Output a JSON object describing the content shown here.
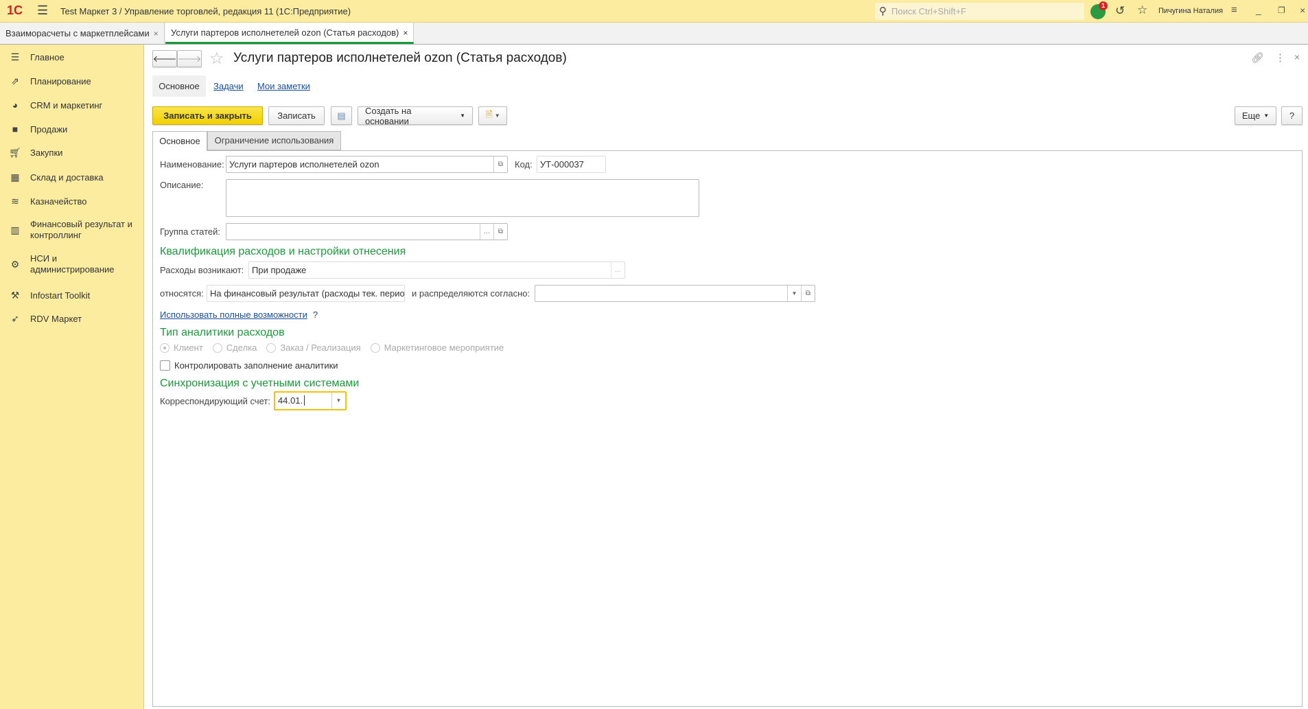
{
  "titlebar": {
    "logo": "1С",
    "title": "Test Маркет 3 / Управление торговлей, редакция 11  (1С:Предприятие)",
    "search_placeholder": "Поиск Ctrl+Shift+F",
    "notification_count": "1",
    "user": "Пичугина Наталия"
  },
  "window_tabs": [
    {
      "label": "Взаиморасчеты с маркетплейсами",
      "close": "×"
    },
    {
      "label": "Услуги партеров исполнетелей ozon (Статья расходов)",
      "close": "×"
    }
  ],
  "sidebar": {
    "items": [
      {
        "label": "Главное",
        "icon": "menu-icon"
      },
      {
        "label": "Планирование",
        "icon": "planning-icon"
      },
      {
        "label": "CRM и маркетинг",
        "icon": "pie-icon"
      },
      {
        "label": "Продажи",
        "icon": "bag-icon"
      },
      {
        "label": "Закупки",
        "icon": "cart-icon"
      },
      {
        "label": "Склад и доставка",
        "icon": "grid-icon"
      },
      {
        "label": "Казначейство",
        "icon": "coins-icon"
      },
      {
        "label": "Финансовый результат и контроллинг",
        "icon": "bar-chart-icon"
      },
      {
        "label": "НСИ и администрирование",
        "icon": "gear-icon"
      },
      {
        "label": "Infostart Toolkit",
        "icon": "tools-icon"
      },
      {
        "label": "RDV Маркет",
        "icon": "rocket-icon"
      }
    ]
  },
  "form": {
    "title": "Услуги партеров исполнетелей ozon (Статья расходов)",
    "subtabs": [
      "Основное",
      "Задачи",
      "Мои заметки"
    ],
    "toolbar": {
      "save_close": "Записать и закрыть",
      "save": "Записать",
      "create_based": "Создать на основании",
      "more": "Еще",
      "help": "?"
    },
    "tabs": [
      "Основное",
      "Ограничение использования"
    ],
    "name_label": "Наименование:",
    "name_value": "Услуги партеров исполнетелей ozon",
    "code_label": "Код:",
    "code_value": "УТ-000037",
    "desc_label": "Описание:",
    "desc_value": "",
    "group_label": "Группа статей:",
    "group_value": "",
    "section1": "Квалификация расходов и настройки отнесения",
    "arise_label": "Расходы возникают:",
    "arise_value": "При продаже",
    "relate_label": "относятся:",
    "relate_value": "На финансовый результат (расходы тек. перио,",
    "distribute_label": "и распределяются согласно:",
    "distribute_value": "",
    "full_link": "Использовать полные возможности",
    "full_help": "?",
    "section2": "Тип аналитики расходов",
    "radios": [
      "Клиент",
      "Сделка",
      "Заказ / Реализация",
      "Маркетинговое мероприятие"
    ],
    "selected_radio": "Клиент",
    "control_label": "Контролировать заполнение аналитики",
    "control_checked": false,
    "section3": "Синхронизация с учетными системами",
    "account_label": "Корреспондирующий счет:",
    "account_value": "44.01."
  }
}
